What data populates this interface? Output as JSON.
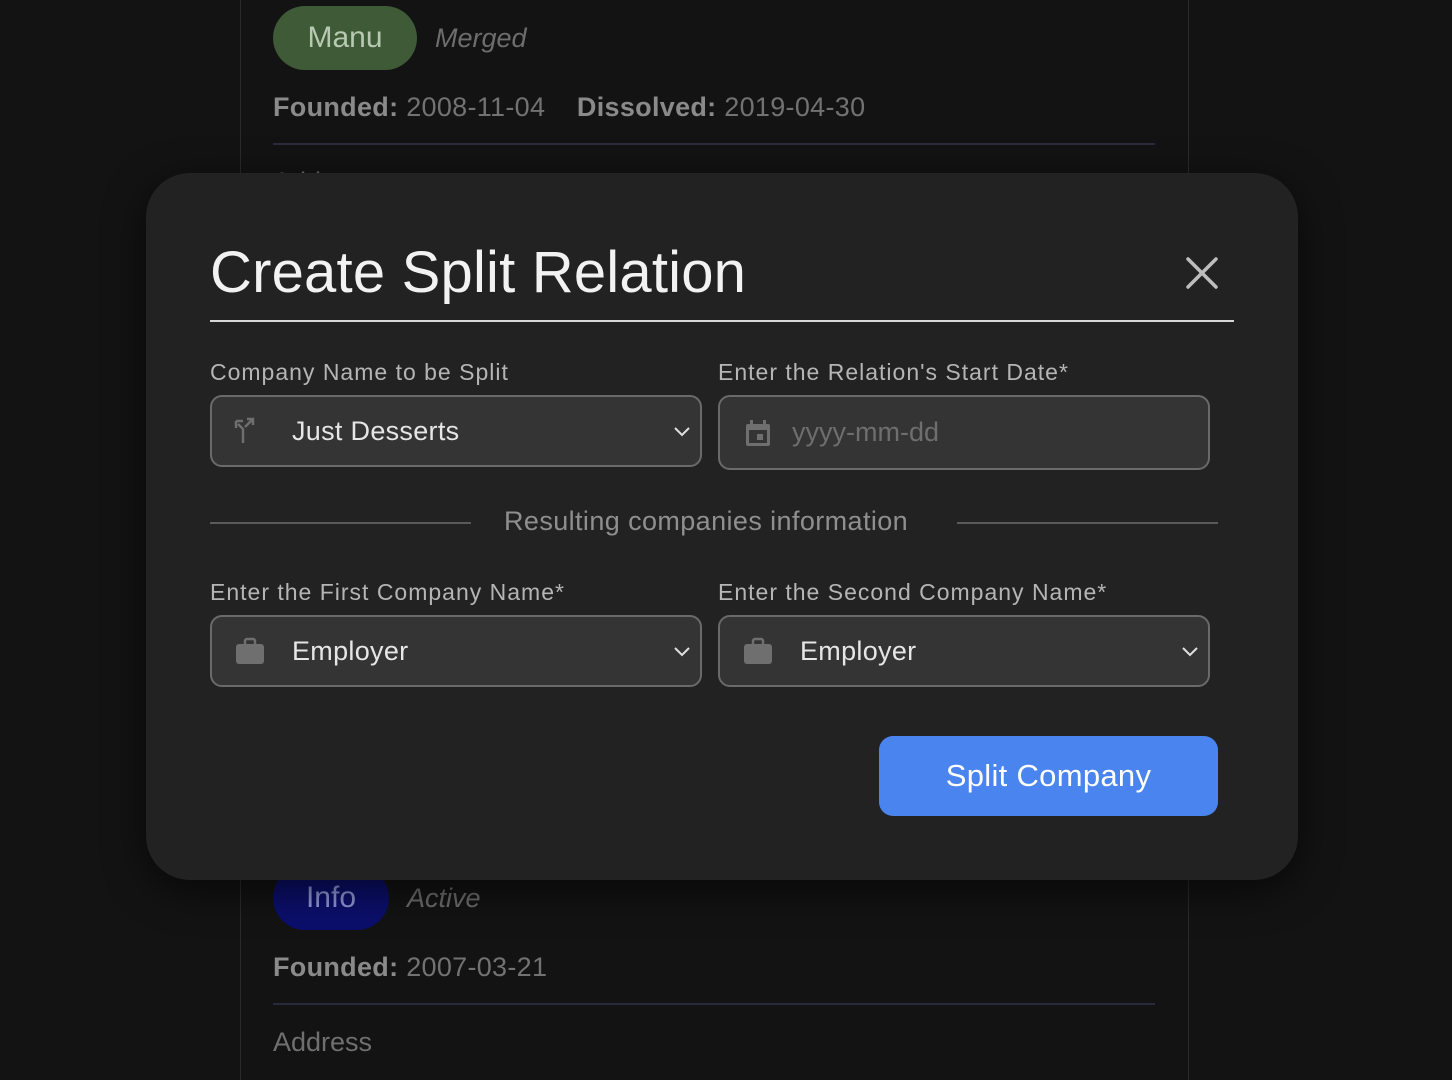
{
  "background": {
    "top_card": {
      "badge": "Manu",
      "status": "Merged",
      "founded_label": "Founded:",
      "founded_value": "2008-11-04",
      "dissolved_label": "Dissolved:",
      "dissolved_value": "2019-04-30",
      "address_label": "Address"
    },
    "bottom_card": {
      "badge": "Info",
      "status": "Active",
      "founded_label": "Founded:",
      "founded_value": "2007-03-21",
      "address_label": "Address"
    }
  },
  "modal": {
    "title": "Create Split Relation",
    "close_icon": "close-icon",
    "company_field": {
      "label": "Company Name to be Split",
      "value": "Just Desserts",
      "icon": "split-arrows-icon"
    },
    "date_field": {
      "label": "Enter the Relation's Start Date*",
      "placeholder": "yyyy-mm-dd",
      "value": "",
      "icon": "calendar-icon"
    },
    "section_title": "Resulting companies information",
    "first_company_field": {
      "label": "Enter the First Company Name*",
      "value": "Employer",
      "icon": "briefcase-icon"
    },
    "second_company_field": {
      "label": "Enter the Second Company Name*",
      "value": "Employer",
      "icon": "briefcase-icon"
    },
    "submit_label": "Split Company"
  },
  "colors": {
    "accent": "#4a84ee",
    "modal_bg": "#222222",
    "page_bg": "#131313",
    "badge_merged": "#3e5a37",
    "badge_active": "#0b0f6b"
  }
}
